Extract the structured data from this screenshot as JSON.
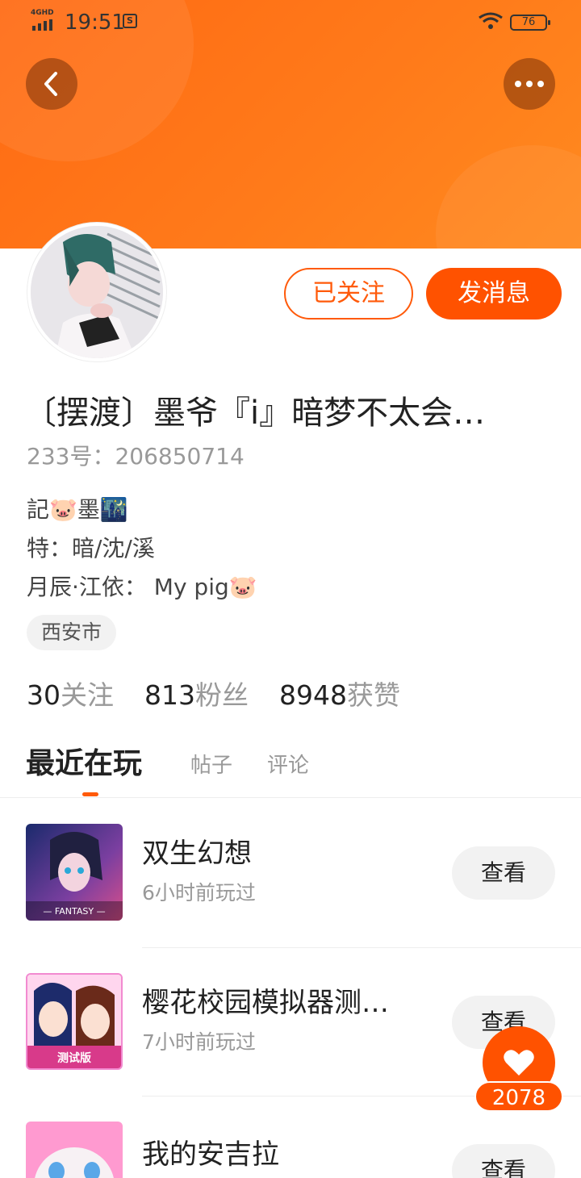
{
  "status_bar": {
    "signal_label": "4GHD",
    "time": "19:51",
    "sim_glyph": "S",
    "battery": "76"
  },
  "profile": {
    "name": "〔摆渡〕墨爷『i』暗梦不太会…",
    "uid": "233号：206850714",
    "bio": [
      "記🐷墨🌃",
      "特：暗/沈/溪",
      "月辰·江依：  My pig🐷"
    ],
    "location": "西安市",
    "follow_button": "已关注",
    "message_button": "发消息"
  },
  "stats": [
    {
      "num": "30",
      "label": "关注"
    },
    {
      "num": "813",
      "label": "粉丝"
    },
    {
      "num": "8948",
      "label": "获赞"
    }
  ],
  "tabs": [
    {
      "label": "最近在玩"
    },
    {
      "label": "帖子"
    },
    {
      "label": "评论"
    }
  ],
  "games": [
    {
      "name": "双生幻想",
      "time": "6小时前玩过",
      "button": "查看",
      "icon_text": "— FANTASY —"
    },
    {
      "name": "樱花校园模拟器测…",
      "time": "7小时前玩过",
      "button": "查看",
      "icon_text": "测试版"
    },
    {
      "name": "我的安吉拉",
      "time": "",
      "button": "查看"
    }
  ],
  "like_fab": {
    "count": "2078"
  },
  "colors": {
    "accent": "#ff5200",
    "header": "#ff7a1a"
  }
}
